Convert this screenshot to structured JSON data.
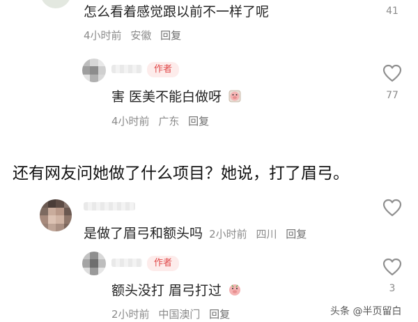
{
  "comments": [
    {
      "text": "怎么看着感觉跟以前不一样了呢",
      "time": "4小时前",
      "location": "安徽",
      "reply": "回复",
      "likes": "41"
    },
    {
      "badge": "作者",
      "text": "害 医美不能白做呀",
      "emoji": "pig-face-emoji",
      "time": "4小时前",
      "location": "广东",
      "reply": "回复",
      "likes": "77"
    },
    {
      "text": "是做了眉弓和额头吗",
      "time": "2小时前",
      "location": "四川",
      "reply": "回复"
    },
    {
      "badge": "作者",
      "text": "额头没打 眉弓打过",
      "emoji": "pig-face-emoji",
      "time": "2小时前",
      "location": "中国澳门",
      "reply": "回复",
      "likes": "3"
    }
  ],
  "caption": "还有网友问她做了什么项目？她说，打了眉弓。",
  "watermark": "头条 @半页留白",
  "colors": {
    "badge_text": "#e0494a",
    "badge_bg": "#fdeceb",
    "meta": "#8a8a8a"
  }
}
